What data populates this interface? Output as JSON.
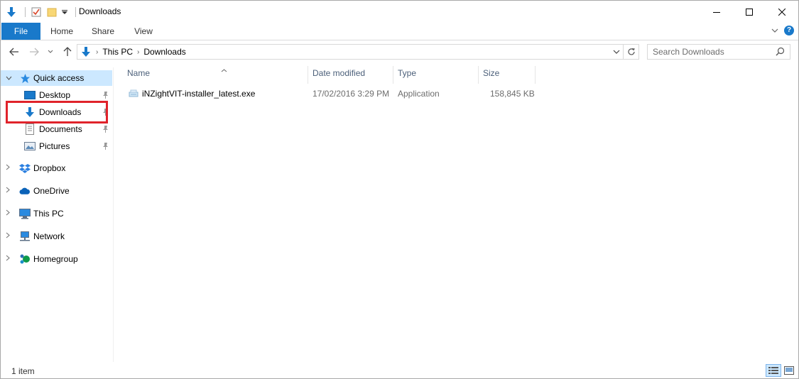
{
  "window": {
    "title": "Downloads"
  },
  "ribbon": {
    "tabs": [
      "File",
      "Home",
      "Share",
      "View"
    ]
  },
  "address": {
    "crumbs": [
      "This PC",
      "Downloads"
    ]
  },
  "search": {
    "placeholder": "Search Downloads"
  },
  "nav": {
    "quick_access": "Quick access",
    "pinned": [
      "Desktop",
      "Downloads",
      "Documents",
      "Pictures"
    ],
    "roots": [
      "Dropbox",
      "OneDrive",
      "This PC",
      "Network",
      "Homegroup"
    ]
  },
  "columns": [
    "Name",
    "Date modified",
    "Type",
    "Size"
  ],
  "files": [
    {
      "name": "iNZightVIT-installer_latest.exe",
      "modified": "17/02/2016 3:29 PM",
      "type": "Application",
      "size": "158,845 KB"
    }
  ],
  "status": {
    "count": "1 item"
  },
  "colors": {
    "accent": "#1979ca",
    "selection": "#cce8ff",
    "highlight_box": "#e0232b"
  }
}
